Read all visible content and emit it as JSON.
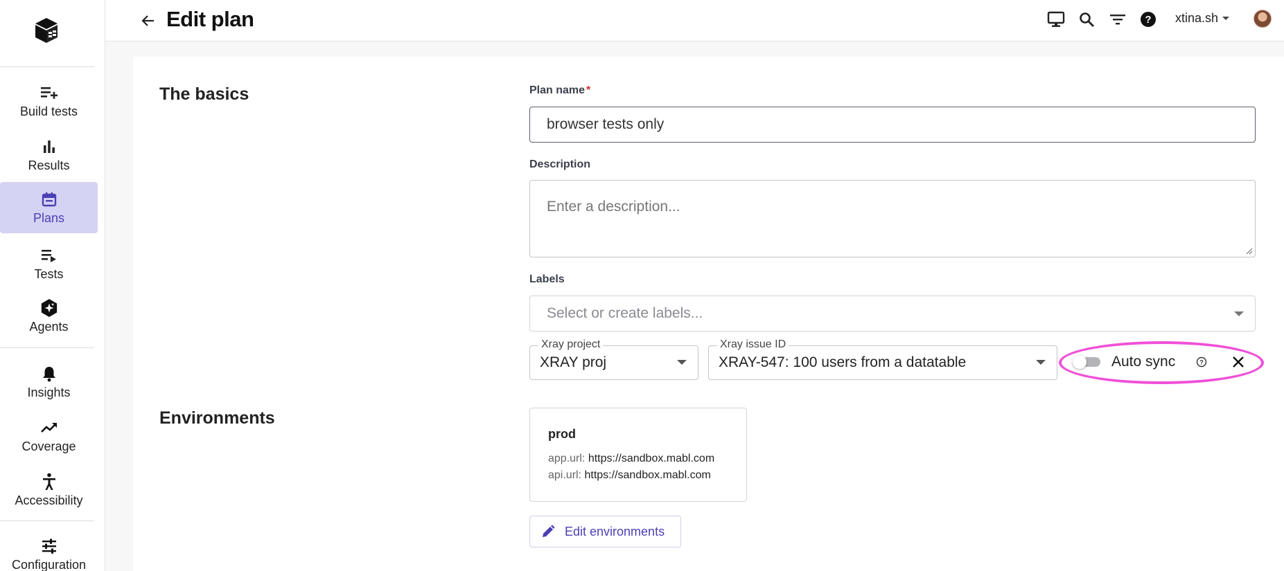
{
  "sidebar": {
    "items": [
      {
        "label": "Build tests",
        "icon": "playlist-add-icon"
      },
      {
        "label": "Results",
        "icon": "bar-chart-icon"
      },
      {
        "label": "Plans",
        "icon": "calendar-icon"
      },
      {
        "label": "Tests",
        "icon": "playlist-play-icon"
      },
      {
        "label": "Agents",
        "icon": "agent-sparkle-icon"
      },
      {
        "label": "Insights",
        "icon": "bell-icon"
      },
      {
        "label": "Coverage",
        "icon": "trending-up-icon"
      },
      {
        "label": "Accessibility",
        "icon": "accessibility-icon"
      },
      {
        "label": "Configuration",
        "icon": "tune-icon"
      }
    ],
    "active_item": "Plans"
  },
  "header": {
    "title": "Edit plan",
    "user": "xtina.sh"
  },
  "basics": {
    "section_title": "The basics",
    "plan_name_label": "Plan name",
    "required_mark": "*",
    "plan_name_value": "browser tests only",
    "description_label": "Description",
    "description_placeholder": "Enter a description...",
    "labels_label": "Labels",
    "labels_placeholder": "Select or create labels...",
    "xray_project_label": "Xray project",
    "xray_project_value": "XRAY proj",
    "xray_issue_label": "Xray issue ID",
    "xray_issue_value": "XRAY-547: 100 users from a datatable",
    "auto_sync_label": "Auto sync",
    "auto_sync_on": false
  },
  "environments": {
    "section_title": "Environments",
    "card": {
      "name": "prod",
      "rows": [
        {
          "key": "app.url:",
          "value": "https://sandbox.mabl.com"
        },
        {
          "key": "api.url:",
          "value": "https://sandbox.mabl.com"
        }
      ]
    },
    "edit_button_label": "Edit environments"
  },
  "colors": {
    "accent": "#4a3fb3",
    "active_nav_bg": "#d5d3f3",
    "highlight": "#f04fd8",
    "required": "#d32f2f"
  }
}
